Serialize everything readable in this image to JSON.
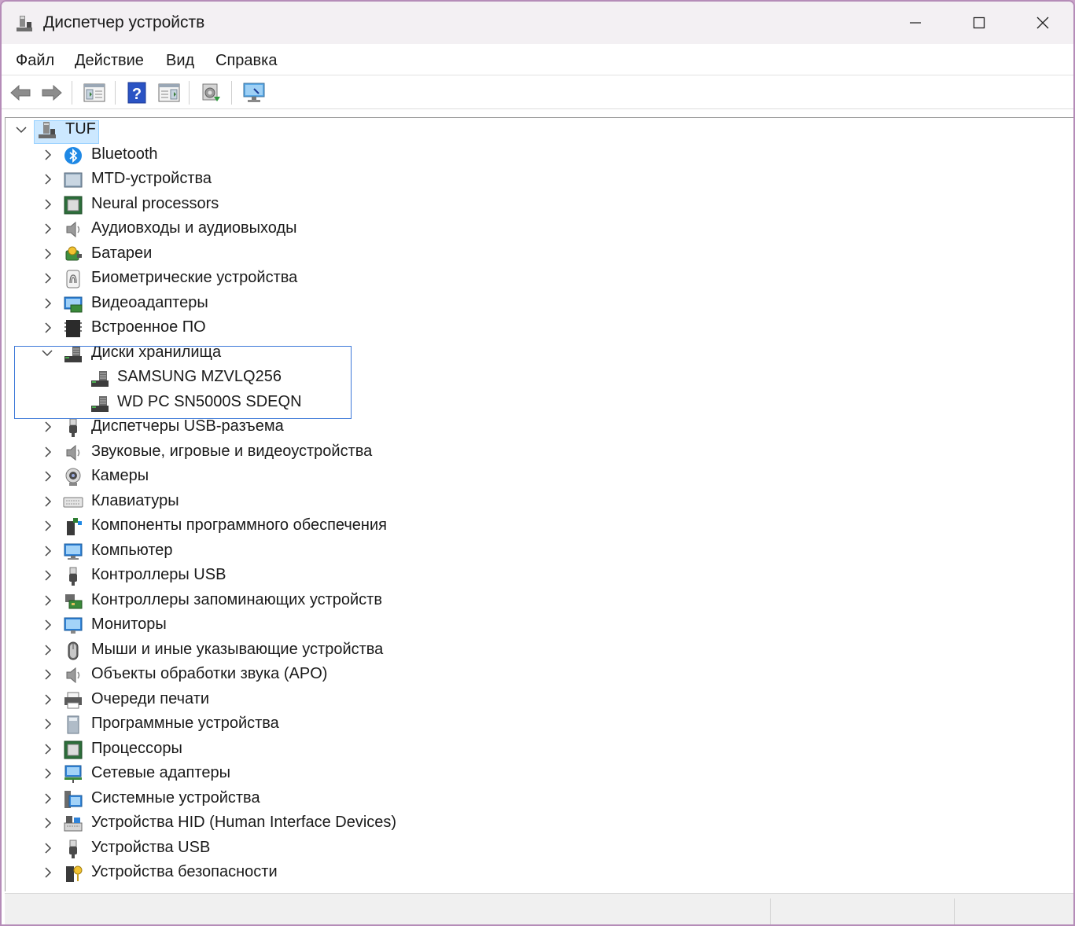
{
  "window": {
    "title": "Диспетчер устройств",
    "controls": {
      "minimize": "minimize",
      "maximize": "maximize",
      "close": "close"
    }
  },
  "menu": {
    "items": [
      "Файл",
      "Действие",
      "Вид",
      "Справка"
    ]
  },
  "toolbar": {
    "buttons": [
      {
        "name": "back-icon"
      },
      {
        "name": "forward-icon"
      },
      {
        "name": "properties-icon"
      },
      {
        "name": "help-icon"
      },
      {
        "name": "view-icon"
      },
      {
        "name": "update-driver-icon"
      },
      {
        "name": "scan-hardware-icon"
      }
    ]
  },
  "tree": {
    "root": "TUF",
    "categories": [
      {
        "label": "Bluetooth",
        "icon": "bluetooth-icon"
      },
      {
        "label": "MTD-устройства",
        "icon": "mtd-icon"
      },
      {
        "label": "Neural processors",
        "icon": "chip-icon"
      },
      {
        "label": "Аудиовходы и аудиовыходы",
        "icon": "speaker-icon"
      },
      {
        "label": "Батареи",
        "icon": "battery-icon"
      },
      {
        "label": "Биометрические устройства",
        "icon": "fingerprint-icon"
      },
      {
        "label": "Видеоадаптеры",
        "icon": "display-adapter-icon"
      },
      {
        "label": "Встроенное ПО",
        "icon": "firmware-icon"
      },
      {
        "label": "Диски хранилища",
        "icon": "disk-drive-icon",
        "expanded": true,
        "children": [
          {
            "label": "SAMSUNG MZVLQ256",
            "icon": "disk-drive-icon"
          },
          {
            "label": "WD PC SN5000S SDEQN",
            "icon": "disk-drive-icon"
          }
        ]
      },
      {
        "label": "Диспетчеры USB-разъема",
        "icon": "usb-connector-icon"
      },
      {
        "label": "Звуковые, игровые и видеоустройства",
        "icon": "speaker-icon"
      },
      {
        "label": "Камеры",
        "icon": "camera-icon"
      },
      {
        "label": "Клавиатуры",
        "icon": "keyboard-icon"
      },
      {
        "label": "Компоненты программного обеспечения",
        "icon": "software-component-icon"
      },
      {
        "label": "Компьютер",
        "icon": "computer-icon"
      },
      {
        "label": "Контроллеры USB",
        "icon": "usb-connector-icon"
      },
      {
        "label": "Контроллеры запоминающих устройств",
        "icon": "storage-controller-icon"
      },
      {
        "label": "Мониторы",
        "icon": "monitor-icon"
      },
      {
        "label": "Мыши и иные указывающие устройства",
        "icon": "mouse-icon"
      },
      {
        "label": "Объекты обработки звука (APO)",
        "icon": "speaker-icon"
      },
      {
        "label": "Очереди печати",
        "icon": "printer-icon"
      },
      {
        "label": "Программные устройства",
        "icon": "software-device-icon"
      },
      {
        "label": "Процессоры",
        "icon": "chip-icon"
      },
      {
        "label": "Сетевые адаптеры",
        "icon": "network-adapter-icon"
      },
      {
        "label": "Системные устройства",
        "icon": "system-device-icon"
      },
      {
        "label": "Устройства HID (Human Interface Devices)",
        "icon": "hid-icon"
      },
      {
        "label": "Устройства USB",
        "icon": "usb-connector-icon"
      },
      {
        "label": "Устройства безопасности",
        "icon": "security-device-icon"
      }
    ]
  },
  "colors": {
    "selection": "#cce8ff",
    "focus_border": "#3c78d8",
    "window_border": "#b58cb8"
  }
}
